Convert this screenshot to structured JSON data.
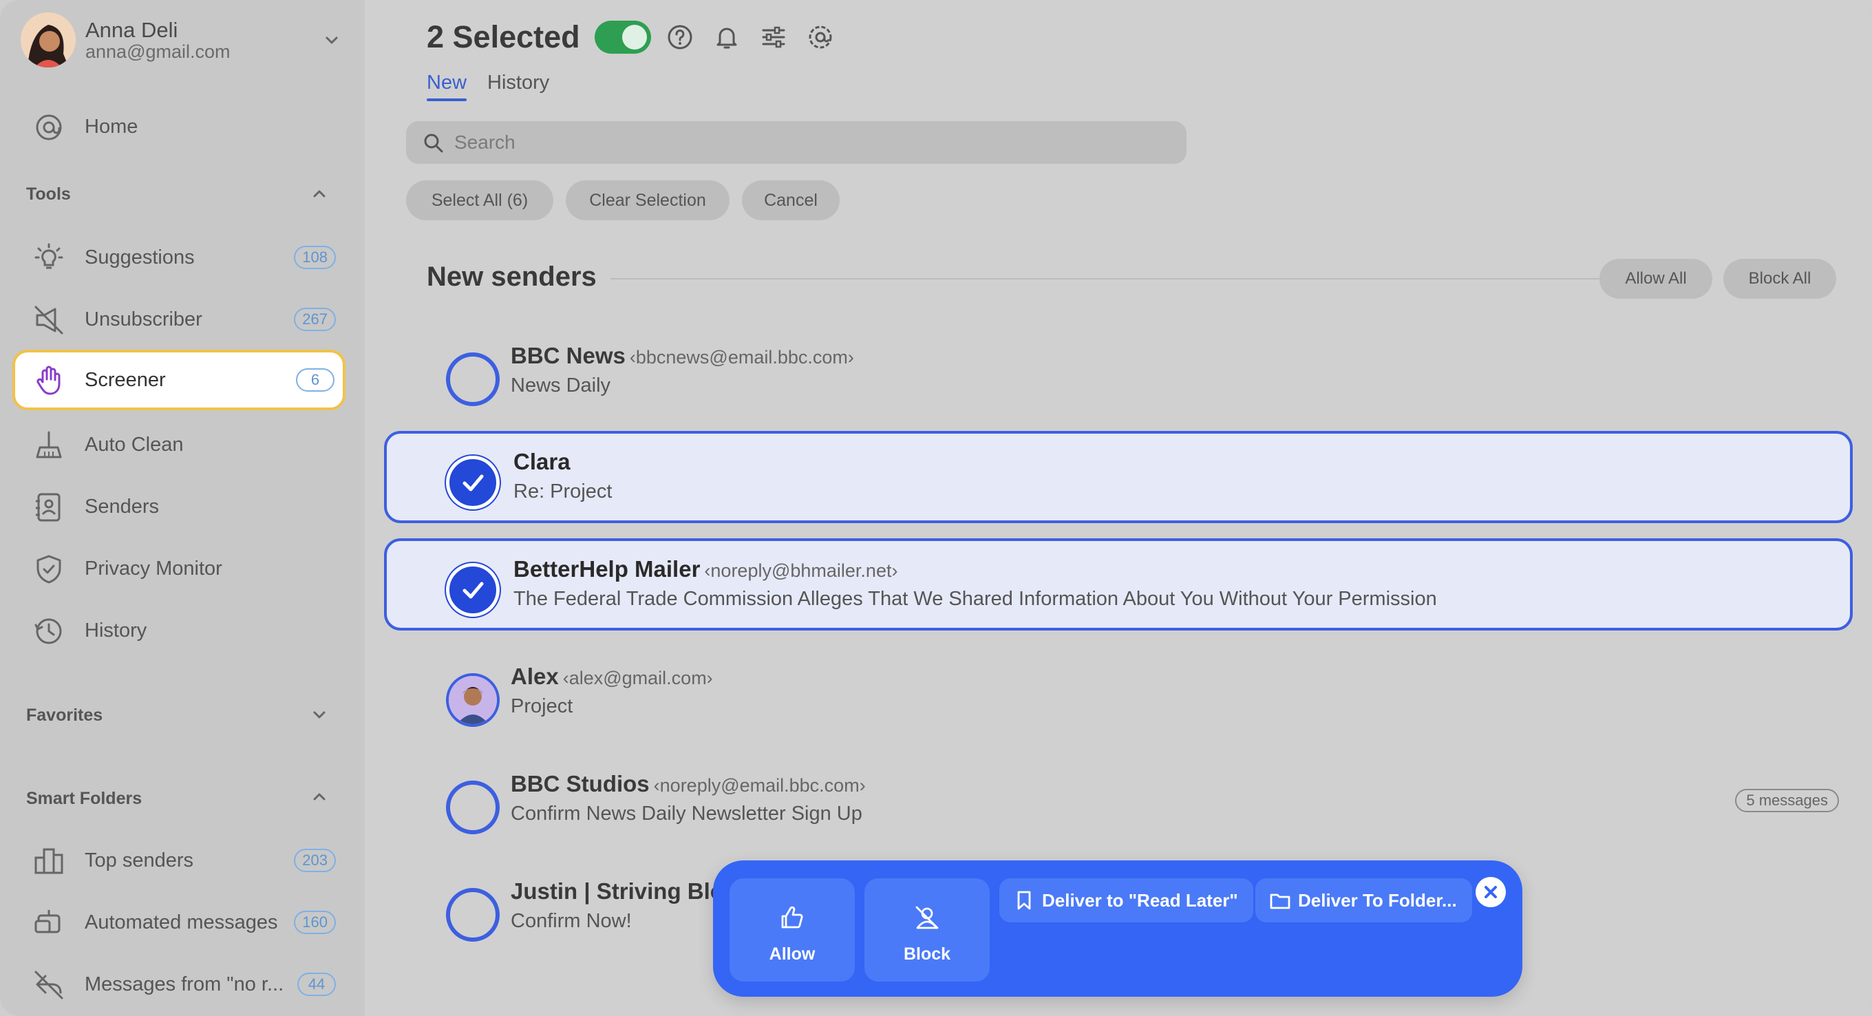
{
  "account": {
    "name": "Anna Deli",
    "email": "anna@gmail.com"
  },
  "sidebar": {
    "home_label": "Home",
    "tools_heading": "Tools",
    "tools": [
      {
        "label": "Suggestions",
        "badge": "108",
        "icon": "lightbulb-icon"
      },
      {
        "label": "Unsubscriber",
        "badge": "267",
        "icon": "unsubscribe-icon"
      },
      {
        "label": "Screener",
        "badge": "6",
        "icon": "hand-icon"
      },
      {
        "label": "Auto Clean",
        "badge": "",
        "icon": "broom-icon"
      },
      {
        "label": "Senders",
        "badge": "",
        "icon": "contacts-icon"
      },
      {
        "label": "Privacy Monitor",
        "badge": "",
        "icon": "shield-icon"
      },
      {
        "label": "History",
        "badge": "",
        "icon": "clock-icon"
      }
    ],
    "favorites_heading": "Favorites",
    "smart_folders_heading": "Smart Folders",
    "smart_folders": [
      {
        "label": "Top senders",
        "badge": "203",
        "icon": "building-icon"
      },
      {
        "label": "Automated messages",
        "badge": "160",
        "icon": "robot-icon"
      },
      {
        "label": "Messages from \"no r...",
        "badge": "44",
        "icon": "no-reply-icon"
      }
    ]
  },
  "header": {
    "title": "2 Selected",
    "toggle_on": true,
    "tabs": [
      "New",
      "History"
    ],
    "active_tab": "New"
  },
  "search": {
    "placeholder": "Search",
    "value": ""
  },
  "selection_actions": {
    "select_all": "Select All (6)",
    "clear": "Clear Selection",
    "cancel": "Cancel"
  },
  "section": {
    "title": "New senders",
    "allow_all": "Allow All",
    "block_all": "Block All"
  },
  "senders": [
    {
      "name": "BBC News",
      "email": "‹bbcnews@email.bbc.com›",
      "subject": "News Daily",
      "selected": false
    },
    {
      "name": "Clara",
      "email": "",
      "subject": "Re: Project",
      "selected": true
    },
    {
      "name": "BetterHelp Mailer",
      "email": "‹noreply@bhmailer.net›",
      "subject": "The Federal Trade Commission Alleges That We Shared Information About You Without Your Permission",
      "selected": true
    },
    {
      "name": "Alex",
      "email": "‹alex@gmail.com›",
      "subject": "Project",
      "selected": false
    },
    {
      "name": "BBC Studios",
      "email": "‹noreply@email.bbc.com›",
      "subject": "Confirm News Daily Newsletter Sign Up",
      "selected": false,
      "count": "5 messages"
    },
    {
      "name": "Justin | Striving Blogg",
      "email": "",
      "subject": "Confirm Now!",
      "selected": false
    }
  ],
  "action_bar": {
    "allow": "Allow",
    "block": "Block",
    "read_later": "Deliver to \"Read Later\"",
    "to_folder": "Deliver To Folder..."
  },
  "colors": {
    "accent": "#3d5fe0",
    "action_bar": "#3465f5",
    "toggle": "#2e9e52",
    "active_border": "#f1c24a"
  }
}
